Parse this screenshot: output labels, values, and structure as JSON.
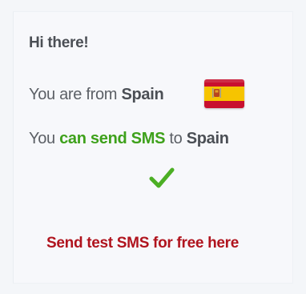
{
  "card": {
    "greeting": "Hi there!",
    "from_prefix": "You are from ",
    "from_country": "Spain",
    "sms_prefix": "You ",
    "sms_capability": "can send SMS",
    "sms_middle": " to ",
    "sms_country": "Spain",
    "flag_icon": "spain-flag-icon",
    "check_icon": "checkmark-icon",
    "cta_label": "Send test SMS for free here"
  },
  "colors": {
    "success_green": "#3ea11b",
    "cta_red": "#b0141e",
    "text_gray": "#5c6066"
  }
}
